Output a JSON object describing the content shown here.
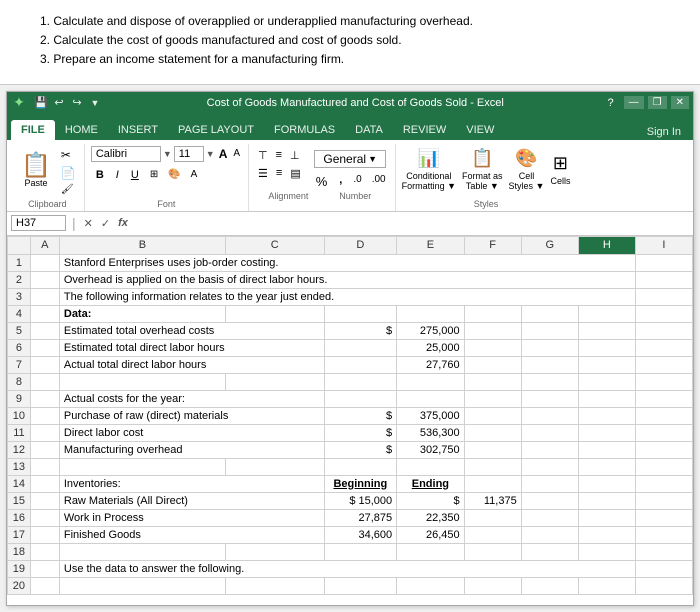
{
  "instructions": {
    "lines": [
      "1. Calculate and dispose of overapplied or underapplied manufacturing overhead.",
      "2. Calculate the cost of goods manufactured and cost of goods sold.",
      "3. Prepare an income statement for a manufacturing firm."
    ]
  },
  "titleBar": {
    "title": "Cost of Goods Manufactured and Cost of Goods Sold - Excel",
    "question": "?",
    "minimize": "—",
    "maximize": "❐",
    "close": "✕"
  },
  "ribbon": {
    "tabs": [
      "FILE",
      "HOME",
      "INSERT",
      "PAGE LAYOUT",
      "FORMULAS",
      "DATA",
      "REVIEW",
      "VIEW"
    ],
    "activeTab": "HOME",
    "signIn": "Sign In"
  },
  "clipboard": {
    "label": "Clipboard",
    "pasteLabel": "Paste"
  },
  "font": {
    "name": "Calibri",
    "size": "11",
    "label": "Font",
    "bold": "B",
    "italic": "I",
    "underline": "U"
  },
  "alignment": {
    "label": "Alignment",
    "numberLabel": "Number",
    "percent": "%"
  },
  "styles": {
    "label": "Styles",
    "conditional": "Conditional\nFormatting ▼",
    "formatAsTable": "Format as\nTable ▼",
    "cellStyles": "Cell\nStyles ▼",
    "cells": "Cells"
  },
  "formulaBar": {
    "cellRef": "H37",
    "xBtn": "✕",
    "checkBtn": "✓",
    "fxBtn": "fx"
  },
  "columns": [
    "",
    "A",
    "B",
    "C",
    "D",
    "E",
    "F",
    "G",
    "H",
    "I"
  ],
  "rows": [
    {
      "num": "1",
      "b": "Stanford Enterprises uses job-order costing.",
      "colspan_b": 7
    },
    {
      "num": "2",
      "b": "Overhead is applied on the basis of direct labor hours.",
      "colspan_b": 7
    },
    {
      "num": "3",
      "b": "The following information relates to the year just ended.",
      "colspan_b": 7
    },
    {
      "num": "4",
      "b": "Data:",
      "bold": true
    },
    {
      "num": "5",
      "b": "Estimated total overhead costs",
      "d": "$",
      "e": "275,000"
    },
    {
      "num": "6",
      "b": "Estimated total direct labor hours",
      "e": "25,000"
    },
    {
      "num": "7",
      "b": "Actual total direct labor hours",
      "e": "27,760"
    },
    {
      "num": "8",
      "b": ""
    },
    {
      "num": "9",
      "b": "Actual costs for the year:"
    },
    {
      "num": "10",
      "b": "Purchase of raw (direct) materials",
      "d": "$",
      "e": "375,000"
    },
    {
      "num": "11",
      "b": "Direct labor cost",
      "d": "$",
      "e": "536,300"
    },
    {
      "num": "12",
      "b": "Manufacturing overhead",
      "d": "$",
      "e": "302,750"
    },
    {
      "num": "13",
      "b": ""
    },
    {
      "num": "14",
      "b": "Inventories:",
      "d": "Beginning",
      "d_bold": true,
      "e": "Ending",
      "e_bold": true
    },
    {
      "num": "15",
      "b": "Raw Materials (All Direct)",
      "d": "$ 15,000",
      "d2": "$",
      "e": "11,375"
    },
    {
      "num": "16",
      "b": "Work in Process",
      "d": "27,875",
      "e": "22,350"
    },
    {
      "num": "17",
      "b": "Finished Goods",
      "d": "34,600",
      "e": "26,450"
    },
    {
      "num": "18",
      "b": ""
    },
    {
      "num": "19",
      "b": "Use the data to answer the following."
    },
    {
      "num": "20",
      "b": ""
    }
  ]
}
